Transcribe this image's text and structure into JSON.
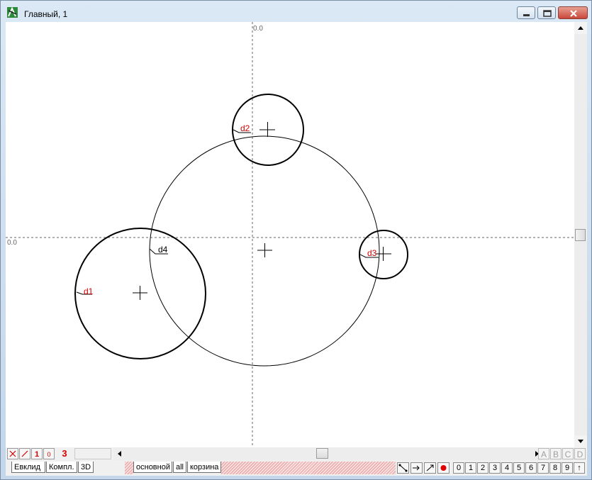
{
  "window": {
    "title": "Главный, 1"
  },
  "canvas": {
    "x_axis_label": "0.0",
    "y_axis_label": "0.0",
    "circles": [
      {
        "label": "d1"
      },
      {
        "label": "d2"
      },
      {
        "label": "d3"
      },
      {
        "label": "d4"
      }
    ]
  },
  "statusbar": {
    "button_1": "1",
    "button_0": "0",
    "counter": "3",
    "letters": [
      "A",
      "B",
      "C",
      "D"
    ]
  },
  "tabs": {
    "left": [
      "Евклид",
      "Компл.",
      "3D"
    ],
    "layers": [
      "основной",
      "all",
      "корзина"
    ]
  },
  "digits": [
    "0",
    "1",
    "2",
    "3",
    "4",
    "5",
    "6",
    "7",
    "8",
    "9",
    "↑"
  ],
  "colors": {
    "label_red": "#d40000",
    "canvas_bg": "#ffffff",
    "titlebar": "#c9dcef"
  }
}
